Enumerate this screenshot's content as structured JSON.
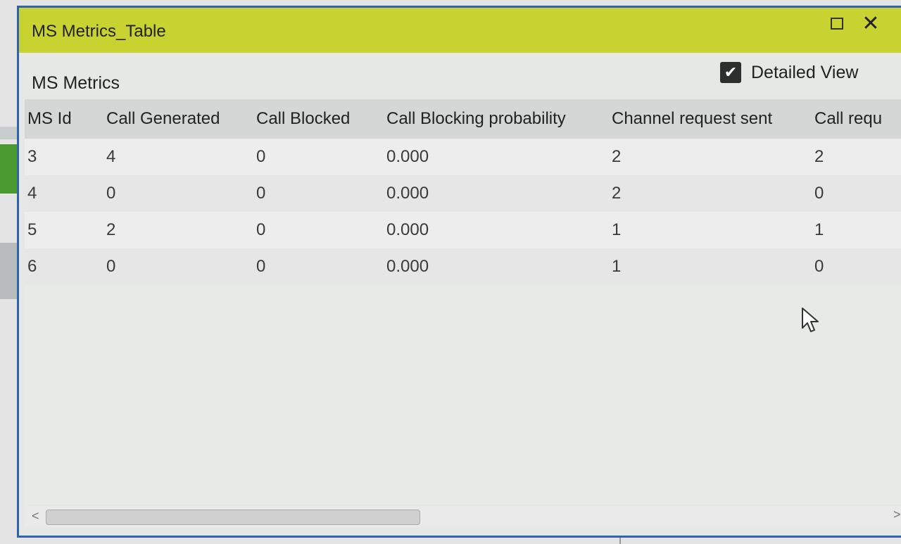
{
  "window": {
    "title": "MS Metrics_Table",
    "close_glyph": "✕"
  },
  "panel": {
    "section_title": "MS Metrics",
    "detailed_view": {
      "label": "Detailed View",
      "checked": true
    }
  },
  "table": {
    "columns": [
      "MS Id",
      "Call Generated",
      "Call Blocked",
      "Call Blocking probability",
      "Channel request sent",
      "Call requ"
    ],
    "rows": [
      [
        "3",
        "4",
        "0",
        "0.000",
        "2",
        "2"
      ],
      [
        "4",
        "0",
        "0",
        "0.000",
        "2",
        "0"
      ],
      [
        "5",
        "2",
        "0",
        "0.000",
        "1",
        "1"
      ],
      [
        "6",
        "0",
        "0",
        "0.000",
        "1",
        "0"
      ]
    ]
  },
  "scrollbar": {
    "left_glyph": "<",
    "right_glyph": ">"
  },
  "colors": {
    "titlebar": "#c8d230",
    "window_border": "#2f63ad",
    "header_bg": "#d5d7d6"
  }
}
